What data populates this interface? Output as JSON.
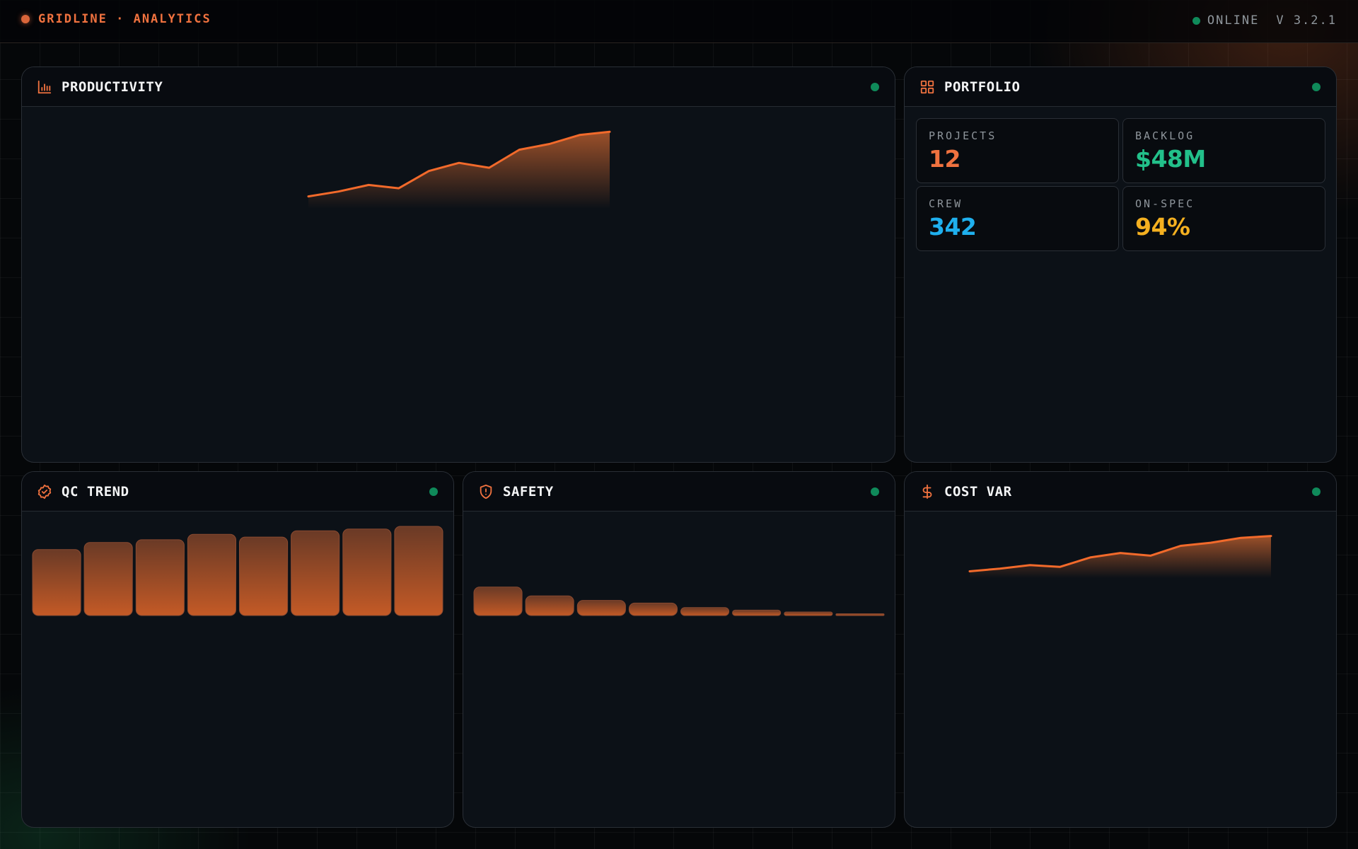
{
  "topbar": {
    "brand": "GRIDLINE · ANALYTICS",
    "status_label": "ONLINE",
    "version": "V 3.2.1"
  },
  "colors": {
    "accent": "#f0723f",
    "online": "#0f8a5a",
    "projects": "#f0723f",
    "backlog": "#22c08a",
    "crew": "#1fb0ee",
    "onspec": "#f4b020"
  },
  "panels": {
    "productivity": {
      "title": "PRODUCTIVITY",
      "icon": "bar-chart-icon"
    },
    "portfolio": {
      "title": "PORTFOLIO",
      "icon": "grid-icon",
      "stats": [
        {
          "label": "PROJECTS",
          "value": "12",
          "color": "#f0723f"
        },
        {
          "label": "BACKLOG",
          "value": "$48M",
          "color": "#22c08a"
        },
        {
          "label": "CREW",
          "value": "342",
          "color": "#1fb0ee"
        },
        {
          "label": "ON-SPEC",
          "value": "94%",
          "color": "#f4b020"
        }
      ]
    },
    "qc_trend": {
      "title": "QC TREND",
      "icon": "badge-check-icon"
    },
    "safety": {
      "title": "SAFETY",
      "icon": "shield-alert-icon"
    },
    "cost_var": {
      "title": "COST VAR",
      "icon": "dollar-icon"
    }
  },
  "chart_data": [
    {
      "panel": "productivity",
      "type": "area",
      "x": [
        1,
        2,
        3,
        4,
        5,
        6,
        7,
        8,
        9,
        10,
        11
      ],
      "values": [
        0,
        6,
        14,
        10,
        31,
        41,
        35,
        57,
        64,
        75,
        79
      ],
      "ylim": [
        -15,
        80
      ]
    },
    {
      "panel": "qc_trend",
      "type": "bar",
      "values": [
        74,
        82,
        85,
        91,
        88,
        95,
        97,
        100
      ],
      "ylim": [
        0,
        100
      ]
    },
    {
      "panel": "safety",
      "type": "bar",
      "values": [
        32,
        22,
        17,
        14,
        9,
        6,
        4,
        2
      ],
      "ylim": [
        0,
        100
      ]
    },
    {
      "panel": "cost_var",
      "type": "area",
      "x": [
        1,
        2,
        3,
        4,
        5,
        6,
        7,
        8,
        9,
        10,
        11
      ],
      "values": [
        0,
        6,
        14,
        10,
        31,
        41,
        35,
        57,
        64,
        75,
        79
      ],
      "ylim": [
        -15,
        80
      ]
    }
  ]
}
